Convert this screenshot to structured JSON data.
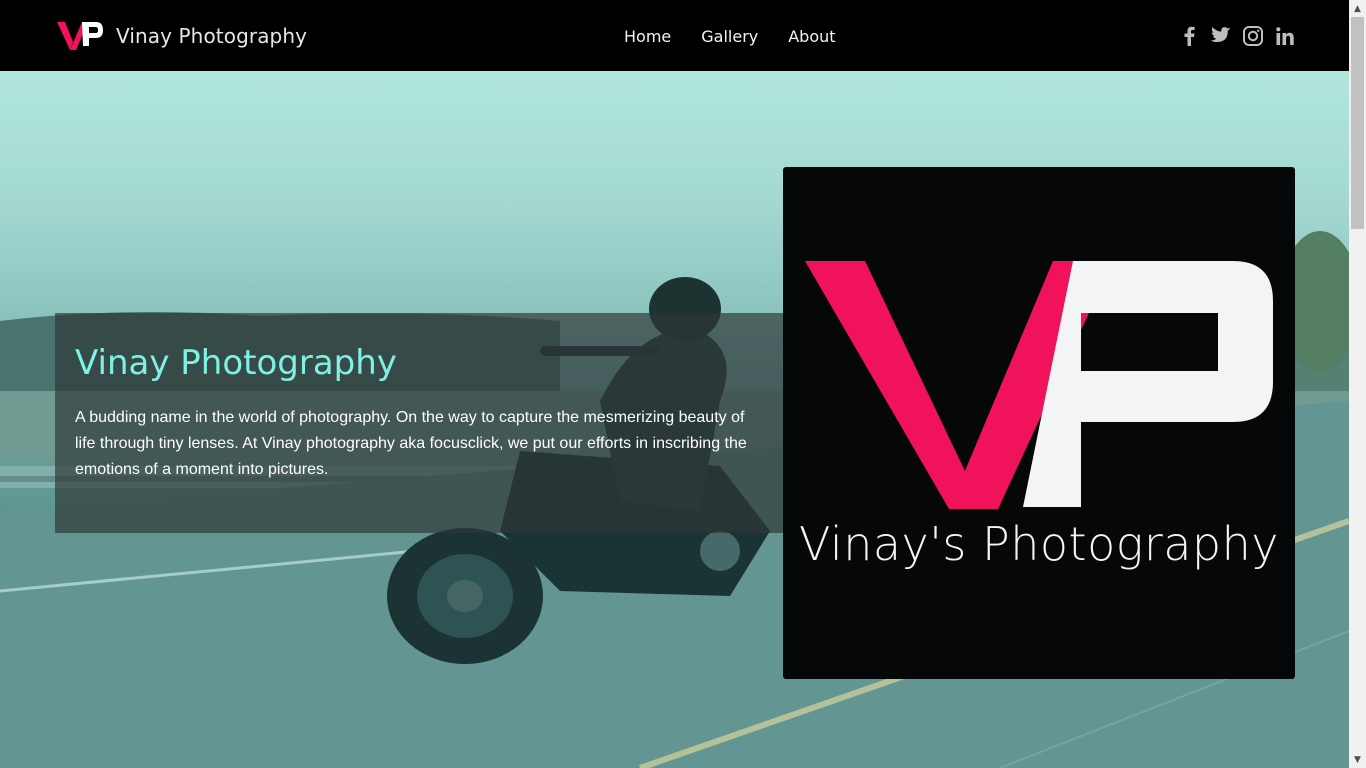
{
  "navbar": {
    "brand_name": "Vinay Photography",
    "links": [
      "Home",
      "Gallery",
      "About"
    ],
    "social_icons": [
      "facebook-icon",
      "twitter-icon",
      "instagram-icon",
      "linkedin-icon"
    ]
  },
  "hero": {
    "title": "Vinay Photography",
    "description": "A budding name in the world of photography. On the way to capture the mesmerizing beauty of life through tiny lenses. At Vinay photography aka focusclick, we put our efforts in inscribing the emotions of a moment into pictures."
  },
  "logo_card": {
    "caption": "Vinay's Photography"
  },
  "colors": {
    "brand_pink": "#f0125a",
    "title_cyan": "#7ff0e4",
    "navbar_bg": "#000000"
  }
}
